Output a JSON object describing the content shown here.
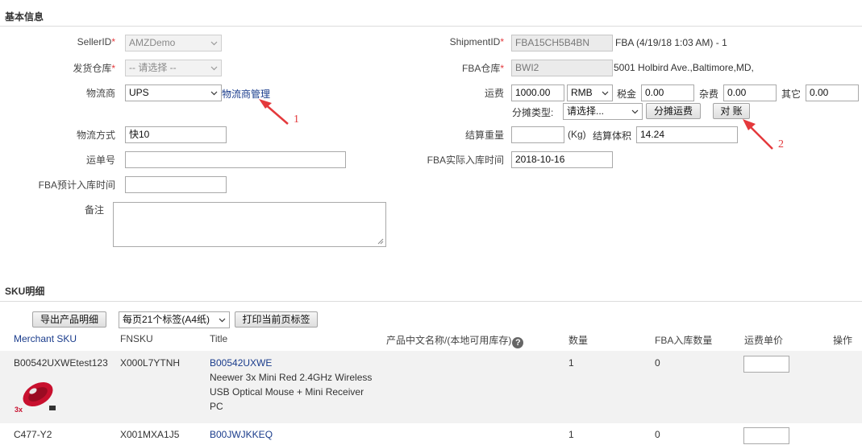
{
  "sections": {
    "basic_info": "基本信息",
    "sku_detail": "SKU明细"
  },
  "left_form": {
    "seller_id": {
      "label": "SellerID",
      "required_mark": "*",
      "value": "AMZDemo"
    },
    "warehouse": {
      "label": "发货仓库",
      "required_mark": "*",
      "value": "-- 请选择 --"
    },
    "carrier": {
      "label": "物流商",
      "value": "UPS",
      "manage_link": "物流商管理"
    },
    "shipping_method": {
      "label": "物流方式",
      "value": "快10"
    },
    "tracking_no": {
      "label": "运单号",
      "value": ""
    },
    "fba_expected_date": {
      "label": "FBA预计入库时间",
      "value": ""
    },
    "remark": {
      "label": "备注",
      "value": ""
    }
  },
  "right_form": {
    "shipment_id": {
      "label": "ShipmentID",
      "required_mark": "*",
      "value": "FBA15CH5B4BN",
      "info": "FBA (4/19/18 1:03 AM) - 1"
    },
    "fba_warehouse": {
      "label": "FBA仓库",
      "required_mark": "*",
      "value": "BWI2",
      "address": "5001 Holbird  Ave.,Baltimore,MD,"
    },
    "freight": {
      "label": "运费",
      "value": "1000.00",
      "currency": "RMB",
      "tax_label": "税金",
      "tax_value": "0.00",
      "misc_label": "杂费",
      "misc_value": "0.00",
      "other_label": "其它",
      "other_value": "0.00"
    },
    "allocation": {
      "label": "分摊类型:",
      "value": "请选择...",
      "allocate_button": "分摊运费",
      "reconcile_button": "对 账"
    },
    "settlement": {
      "weight_label": "结算重量",
      "weight_value": "",
      "weight_unit": "(Kg)",
      "volume_label": "结算体积",
      "volume_value": "14.24"
    },
    "fba_actual_date": {
      "label": "FBA实际入库时间",
      "value": "2018-10-16"
    }
  },
  "annotations": {
    "arrow1": "1",
    "arrow2": "2"
  },
  "sku_toolbar": {
    "export_button": "导出产品明细",
    "label_select": "每页21个标签(A4纸)",
    "print_button": "打印当前页标签"
  },
  "table": {
    "headers": {
      "merchant_sku": "Merchant SKU",
      "fnsku": "FNSKU",
      "title": "Title",
      "cn_name": "产品中文名称/(本地可用库存)",
      "qty": "数量",
      "fba_qty": "FBA入库数量",
      "unit_freight": "运费单价",
      "actions": "操作"
    },
    "rows": [
      {
        "merchant_sku": "B00542UXWEtest123",
        "fnsku": "X000L7YTNH",
        "asin": "B00542UXWE",
        "title_lines": [
          "Neewer 3x Mini Red 2.4GHz Wireless",
          "USB Optical Mouse + Mini Receiver",
          "PC"
        ],
        "qty": "1",
        "fba_qty": "0",
        "unit_freight": "",
        "thumb_badge": "3x"
      },
      {
        "merchant_sku": "C477-Y2",
        "fnsku": "X001MXA1J5",
        "asin": "B00JWJKKEQ",
        "title_lines": [],
        "qty": "1",
        "fba_qty": "0",
        "unit_freight": ""
      }
    ]
  },
  "colors": {
    "link": "#1a3c8c",
    "required": "#e4393c",
    "row_alt": "#f2f2f2"
  }
}
